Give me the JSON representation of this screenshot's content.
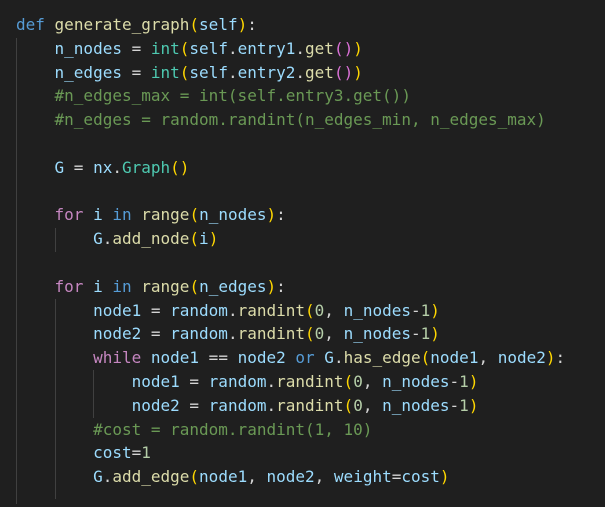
{
  "editor": {
    "theme_colors": {
      "background": "#1f1f1f",
      "keyword": "#569cd6",
      "control": "#c586c0",
      "function": "#dcdcaa",
      "variable": "#9cdcfe",
      "class": "#4ec9b0",
      "number": "#b5cea8",
      "comment": "#6a9955",
      "bracket1": "#ffd700",
      "bracket2": "#da70d6",
      "bracket3": "#179fff"
    },
    "lines": [
      [
        [
          "kw",
          "def"
        ],
        [
          "op",
          " "
        ],
        [
          "fn",
          "generate_graph"
        ],
        [
          "p1",
          "("
        ],
        [
          "var",
          "self"
        ],
        [
          "p1",
          ")"
        ],
        [
          "op",
          ":"
        ]
      ],
      [
        [
          "op",
          "    "
        ],
        [
          "var",
          "n_nodes"
        ],
        [
          "op",
          " = "
        ],
        [
          "cls",
          "int"
        ],
        [
          "p1",
          "("
        ],
        [
          "var",
          "self"
        ],
        [
          "op",
          "."
        ],
        [
          "var",
          "entry1"
        ],
        [
          "op",
          "."
        ],
        [
          "fn",
          "get"
        ],
        [
          "p2",
          "()"
        ],
        [
          "p1",
          ")"
        ]
      ],
      [
        [
          "op",
          "    "
        ],
        [
          "var",
          "n_edges"
        ],
        [
          "op",
          " = "
        ],
        [
          "cls",
          "int"
        ],
        [
          "p1",
          "("
        ],
        [
          "var",
          "self"
        ],
        [
          "op",
          "."
        ],
        [
          "var",
          "entry2"
        ],
        [
          "op",
          "."
        ],
        [
          "fn",
          "get"
        ],
        [
          "p2",
          "()"
        ],
        [
          "p1",
          ")"
        ]
      ],
      [
        [
          "op",
          "    "
        ],
        [
          "cmt",
          "#n_edges_max = int(self.entry3.get())"
        ]
      ],
      [
        [
          "op",
          "    "
        ],
        [
          "cmt",
          "#n_edges = random.randint(n_edges_min, n_edges_max)"
        ]
      ],
      [],
      [
        [
          "op",
          "    "
        ],
        [
          "var",
          "G"
        ],
        [
          "op",
          " = "
        ],
        [
          "var",
          "nx"
        ],
        [
          "op",
          "."
        ],
        [
          "cls",
          "Graph"
        ],
        [
          "p1",
          "()"
        ]
      ],
      [],
      [
        [
          "op",
          "    "
        ],
        [
          "ctrl",
          "for"
        ],
        [
          "op",
          " "
        ],
        [
          "var",
          "i"
        ],
        [
          "op",
          " "
        ],
        [
          "kw",
          "in"
        ],
        [
          "op",
          " "
        ],
        [
          "fn",
          "range"
        ],
        [
          "p1",
          "("
        ],
        [
          "var",
          "n_nodes"
        ],
        [
          "p1",
          ")"
        ],
        [
          "op",
          ":"
        ]
      ],
      [
        [
          "op",
          "        "
        ],
        [
          "var",
          "G"
        ],
        [
          "op",
          "."
        ],
        [
          "fn",
          "add_node"
        ],
        [
          "p1",
          "("
        ],
        [
          "var",
          "i"
        ],
        [
          "p1",
          ")"
        ]
      ],
      [],
      [
        [
          "op",
          "    "
        ],
        [
          "ctrl",
          "for"
        ],
        [
          "op",
          " "
        ],
        [
          "var",
          "i"
        ],
        [
          "op",
          " "
        ],
        [
          "kw",
          "in"
        ],
        [
          "op",
          " "
        ],
        [
          "fn",
          "range"
        ],
        [
          "p1",
          "("
        ],
        [
          "var",
          "n_edges"
        ],
        [
          "p1",
          ")"
        ],
        [
          "op",
          ":"
        ]
      ],
      [
        [
          "op",
          "        "
        ],
        [
          "var",
          "node1"
        ],
        [
          "op",
          " = "
        ],
        [
          "var",
          "random"
        ],
        [
          "op",
          "."
        ],
        [
          "fn",
          "randint"
        ],
        [
          "p1",
          "("
        ],
        [
          "num",
          "0"
        ],
        [
          "op",
          ", "
        ],
        [
          "var",
          "n_nodes"
        ],
        [
          "op",
          "-"
        ],
        [
          "num",
          "1"
        ],
        [
          "p1",
          ")"
        ]
      ],
      [
        [
          "op",
          "        "
        ],
        [
          "var",
          "node2"
        ],
        [
          "op",
          " = "
        ],
        [
          "var",
          "random"
        ],
        [
          "op",
          "."
        ],
        [
          "fn",
          "randint"
        ],
        [
          "p1",
          "("
        ],
        [
          "num",
          "0"
        ],
        [
          "op",
          ", "
        ],
        [
          "var",
          "n_nodes"
        ],
        [
          "op",
          "-"
        ],
        [
          "num",
          "1"
        ],
        [
          "p1",
          ")"
        ]
      ],
      [
        [
          "op",
          "        "
        ],
        [
          "ctrl",
          "while"
        ],
        [
          "op",
          " "
        ],
        [
          "var",
          "node1"
        ],
        [
          "op",
          " == "
        ],
        [
          "var",
          "node2"
        ],
        [
          "op",
          " "
        ],
        [
          "kw",
          "or"
        ],
        [
          "op",
          " "
        ],
        [
          "var",
          "G"
        ],
        [
          "op",
          "."
        ],
        [
          "fn",
          "has_edge"
        ],
        [
          "p1",
          "("
        ],
        [
          "var",
          "node1"
        ],
        [
          "op",
          ", "
        ],
        [
          "var",
          "node2"
        ],
        [
          "p1",
          ")"
        ],
        [
          "op",
          ":"
        ]
      ],
      [
        [
          "op",
          "            "
        ],
        [
          "var",
          "node1"
        ],
        [
          "op",
          " = "
        ],
        [
          "var",
          "random"
        ],
        [
          "op",
          "."
        ],
        [
          "fn",
          "randint"
        ],
        [
          "p1",
          "("
        ],
        [
          "num",
          "0"
        ],
        [
          "op",
          ", "
        ],
        [
          "var",
          "n_nodes"
        ],
        [
          "op",
          "-"
        ],
        [
          "num",
          "1"
        ],
        [
          "p1",
          ")"
        ]
      ],
      [
        [
          "op",
          "            "
        ],
        [
          "var",
          "node2"
        ],
        [
          "op",
          " = "
        ],
        [
          "var",
          "random"
        ],
        [
          "op",
          "."
        ],
        [
          "fn",
          "randint"
        ],
        [
          "p1",
          "("
        ],
        [
          "num",
          "0"
        ],
        [
          "op",
          ", "
        ],
        [
          "var",
          "n_nodes"
        ],
        [
          "op",
          "-"
        ],
        [
          "num",
          "1"
        ],
        [
          "p1",
          ")"
        ]
      ],
      [
        [
          "op",
          "        "
        ],
        [
          "cmt",
          "#cost = random.randint(1, 10)"
        ]
      ],
      [
        [
          "op",
          "        "
        ],
        [
          "var",
          "cost"
        ],
        [
          "op",
          "="
        ],
        [
          "num",
          "1"
        ]
      ],
      [
        [
          "op",
          "        "
        ],
        [
          "var",
          "G"
        ],
        [
          "op",
          "."
        ],
        [
          "fn",
          "add_edge"
        ],
        [
          "p1",
          "("
        ],
        [
          "var",
          "node1"
        ],
        [
          "op",
          ", "
        ],
        [
          "var",
          "node2"
        ],
        [
          "op",
          ", "
        ],
        [
          "var",
          "weight"
        ],
        [
          "op",
          "="
        ],
        [
          "var",
          "cost"
        ],
        [
          "p1",
          ")"
        ]
      ]
    ]
  }
}
